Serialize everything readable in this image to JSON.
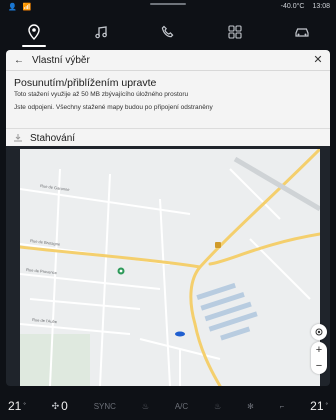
{
  "status_bar": {
    "temperature": "-40.0°C",
    "time": "13:08"
  },
  "nav": {
    "items": [
      {
        "icon": "navigation-icon"
      },
      {
        "icon": "music-icon"
      },
      {
        "icon": "phone-icon"
      },
      {
        "icon": "apps-icon"
      },
      {
        "icon": "car-icon"
      }
    ]
  },
  "dialog": {
    "title": "Vlastní výběr",
    "heading": "Posunutím/přiblížením upravte",
    "subtext": "Toto stažení využije až 50 MB zbývajícího úložného prostoru",
    "warning": "Jste odpojeni. Všechny stažené mapy budou po připojení odstraněny",
    "downloads_label": "Stahování"
  },
  "map": {
    "road_labels": [
      "Rue de Garonne",
      "Rue de Bretagne",
      "Rue de Provence",
      "Rue de l'Aube"
    ]
  },
  "map_controls": {
    "zoom_in": "+",
    "zoom_out": "−"
  },
  "climate": {
    "left_temp": "21",
    "fan_level": "0",
    "sync_label": "SYNC",
    "ac_label": "A/C",
    "right_temp": "21"
  }
}
